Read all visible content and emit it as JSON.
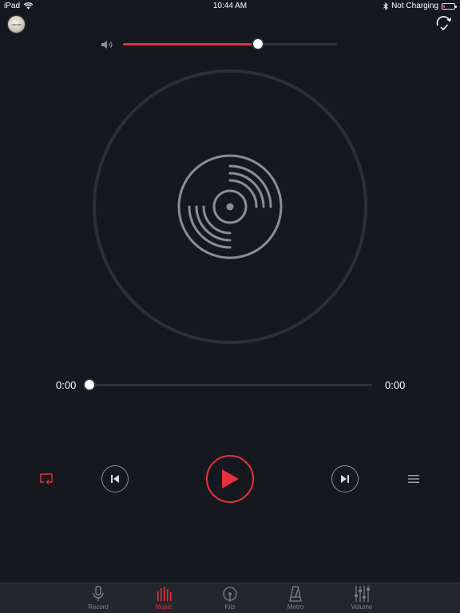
{
  "status_bar": {
    "device": "iPad",
    "time": "10:44 AM",
    "charging": "Not Charging",
    "battery_level": 0.1
  },
  "volume": {
    "level": 0.63
  },
  "player": {
    "current_time": "0:00",
    "total_time": "0:00",
    "progress": 0.0
  },
  "tabs": [
    {
      "label": "Record",
      "icon": "microphone-icon"
    },
    {
      "label": "Music",
      "icon": "equalizer-bars-icon"
    },
    {
      "label": "Kits",
      "icon": "drum-kit-icon"
    },
    {
      "label": "Metro",
      "icon": "metronome-icon"
    },
    {
      "label": "Volume",
      "icon": "mixer-sliders-icon"
    }
  ],
  "active_tab": "Music",
  "colors": {
    "background": "#15191f",
    "accent": "#e8303d",
    "track": "#2f343b",
    "icon_gray": "#8e9196",
    "tab_bar": "#23272d"
  }
}
